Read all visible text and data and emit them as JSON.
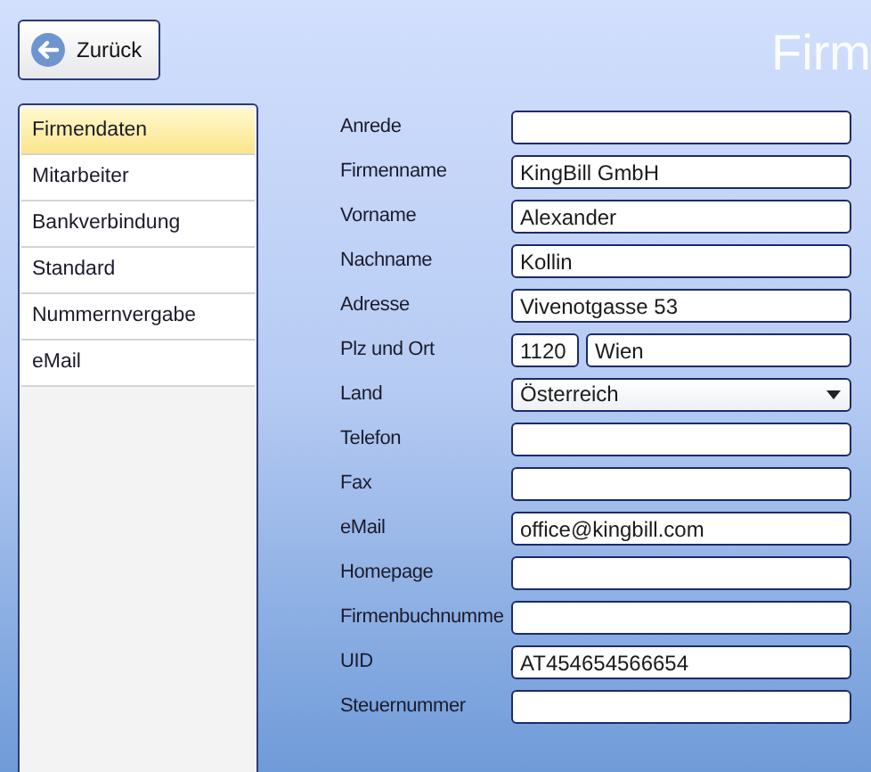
{
  "back_button": {
    "label": "Zurück"
  },
  "title": "Firm",
  "sidebar": {
    "items": [
      {
        "label": "Firmendaten",
        "selected": true
      },
      {
        "label": "Mitarbeiter",
        "selected": false
      },
      {
        "label": "Bankverbindung",
        "selected": false
      },
      {
        "label": "Standard",
        "selected": false
      },
      {
        "label": "Nummernvergabe",
        "selected": false
      },
      {
        "label": "eMail",
        "selected": false
      }
    ]
  },
  "form": {
    "fields": [
      {
        "kind": "text",
        "label": "Anrede"
      },
      {
        "kind": "text",
        "label": "Firmenname",
        "value": "KingBill GmbH"
      },
      {
        "kind": "text",
        "label": "Vorname",
        "value": "Alexander"
      },
      {
        "kind": "text",
        "label": "Nachname",
        "value": "Kollin"
      },
      {
        "kind": "text",
        "label": "Adresse",
        "value": "Vivenotgasse 53"
      },
      {
        "kind": "split",
        "label": "Plz und Ort",
        "value": "1120",
        "value_2": "Wien"
      },
      {
        "kind": "select",
        "label": "Land",
        "value": "Österreich"
      },
      {
        "kind": "text",
        "label": "Telefon"
      },
      {
        "kind": "text",
        "label": "Fax"
      },
      {
        "kind": "text",
        "label": "eMail",
        "value": "office@kingbill.com"
      },
      {
        "kind": "text",
        "label": "Homepage"
      },
      {
        "kind": "text",
        "label": "Firmenbuchnumme"
      },
      {
        "kind": "text",
        "label": "UID",
        "value": "AT454654566654"
      },
      {
        "kind": "text",
        "label": "Steuernummer"
      }
    ]
  }
}
